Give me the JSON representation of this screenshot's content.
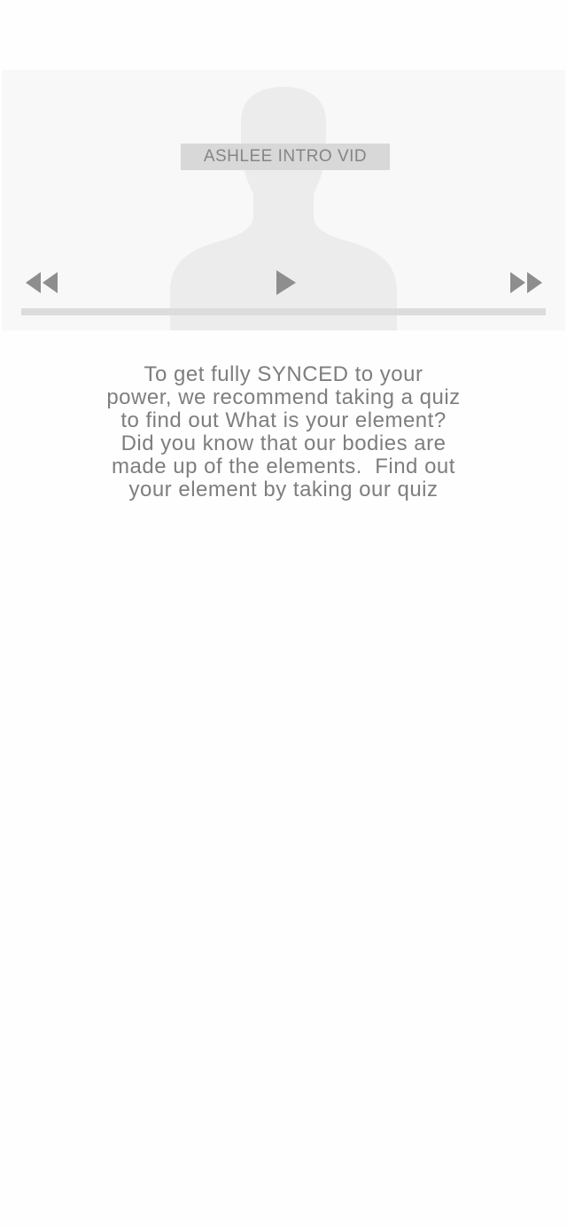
{
  "video": {
    "title": "ASHLEE INTRO VID",
    "progress": 0,
    "controls": {
      "rewind_icon": "rewind-icon",
      "play_icon": "play-icon",
      "fast_forward_icon": "fast-forward-icon"
    },
    "placeholder_icon": "person-silhouette-icon"
  },
  "intro": {
    "text": "To get fully SYNCED to your\npower, we recommend taking a quiz\nto find out What is your element?\nDid you know that our bodies are\nmade up of the elements.  Find out\nyour element by taking our quiz"
  },
  "colors": {
    "background": "#fefefe",
    "player_background": "#f8f8f8",
    "silhouette": "#ececec",
    "control": "#8e8e8e",
    "title_badge": "#d8d8d8",
    "text": "#7e7e7e"
  }
}
